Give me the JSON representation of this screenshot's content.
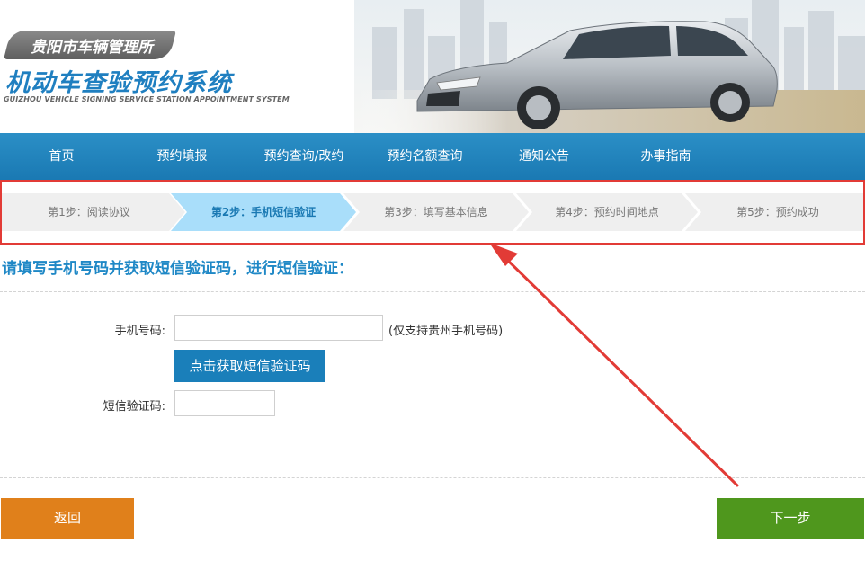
{
  "header": {
    "agency": "贵阳市车辆管理所",
    "title": "机动车查验预约系统",
    "subtitle": "GUIZHOU VEHICLE SIGNING SERVICE STATION APPOINTMENT SYSTEM"
  },
  "nav": {
    "items": [
      {
        "label": "首页"
      },
      {
        "label": "预约填报"
      },
      {
        "label": "预约查询/改约"
      },
      {
        "label": "预约名额查询"
      },
      {
        "label": "通知公告"
      },
      {
        "label": "办事指南"
      }
    ]
  },
  "steps": [
    {
      "label": "第1步：阅读协议",
      "active": false
    },
    {
      "label": "第2步：手机短信验证",
      "active": true
    },
    {
      "label": "第3步：填写基本信息",
      "active": false
    },
    {
      "label": "第4步：预约时间地点",
      "active": false
    },
    {
      "label": "第5步：预约成功",
      "active": false
    }
  ],
  "form": {
    "instruction": "请填写手机号码并获取短信验证码，进行短信验证：",
    "phone_label": "手机号码:",
    "phone_value": "",
    "phone_hint": "(仅支持贵州手机号码)",
    "sms_button": "点击获取短信验证码",
    "code_label": "短信验证码:",
    "code_value": ""
  },
  "actions": {
    "back": "返回",
    "next": "下一步"
  },
  "colors": {
    "nav": "#1a79b3",
    "active_step": "#a9defa",
    "highlight_box": "#e23b36",
    "back_button": "#e0801b",
    "next_button": "#4f971d"
  }
}
